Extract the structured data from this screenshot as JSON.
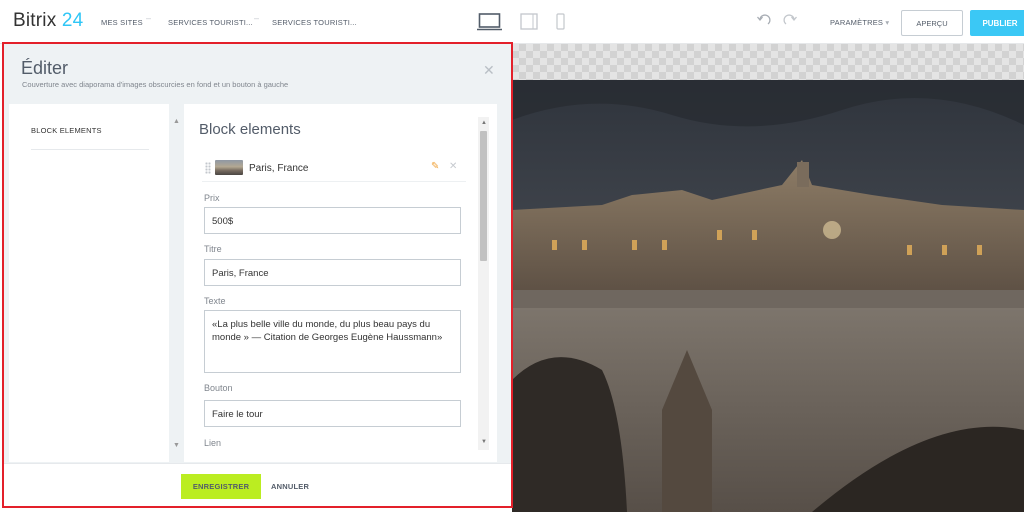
{
  "header": {
    "logo_name": "Bitrix",
    "logo_number": "24",
    "breadcrumbs": [
      "MES SITES",
      "SERVICES TOURISTI...",
      "SERVICES TOURISTI..."
    ],
    "devices": [
      "desktop-icon",
      "tablet-icon",
      "mobile-icon"
    ],
    "params_label": "PARAMÈTRES",
    "preview_label": "APERÇU",
    "publish_label": "PUBLIER",
    "accent_color": "#3bc8f5"
  },
  "editor": {
    "title": "Éditer",
    "subtitle": "Couverture avec diaporama d'images obscurcies en fond et un bouton à gauche",
    "sidebar": {
      "items": [
        {
          "label": "BLOCK ELEMENTS"
        }
      ]
    },
    "content_title": "Block elements",
    "element": {
      "label": "Paris, France"
    },
    "fields": {
      "price": {
        "label": "Prix",
        "value": "500$"
      },
      "title": {
        "label": "Titre",
        "value": "Paris, France"
      },
      "text": {
        "label": "Texte",
        "value": "«La plus belle ville du monde, du plus beau pays du monde » — Citation de Georges Eugène Haussmann»"
      },
      "button": {
        "label": "Bouton",
        "value": "Faire le tour"
      },
      "link": {
        "label": "Lien"
      }
    },
    "footer": {
      "save_label": "ENREGISTRER",
      "cancel_label": "ANNULER",
      "save_color": "#bbed21"
    }
  }
}
